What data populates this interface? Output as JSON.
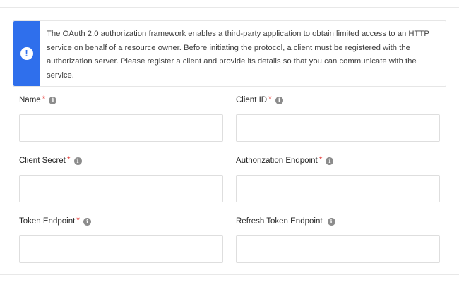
{
  "notice": {
    "icon": "exclamation-icon",
    "accent_color": "#2f6fec",
    "text": "The OAuth 2.0 authorization framework enables a third-party application to obtain limited access to an HTTP service on behalf of a resource owner. Before initiating the protocol, a client must be registered with the authorization server. Please register a client and provide its details so that you can communicate with the service."
  },
  "form": {
    "name": {
      "label": "Name",
      "required": true,
      "value": ""
    },
    "client_id": {
      "label": "Client ID",
      "required": true,
      "value": ""
    },
    "client_secret": {
      "label": "Client Secret",
      "required": true,
      "value": ""
    },
    "authorization_endpoint": {
      "label": "Authorization Endpoint",
      "required": true,
      "value": ""
    },
    "token_endpoint": {
      "label": "Token Endpoint",
      "required": true,
      "value": ""
    },
    "refresh_token_endpoint": {
      "label": "Refresh Token Endpoint",
      "required": false,
      "value": ""
    }
  },
  "required_marker": "*",
  "required_color": "#e53935",
  "info_icon": "info-icon"
}
